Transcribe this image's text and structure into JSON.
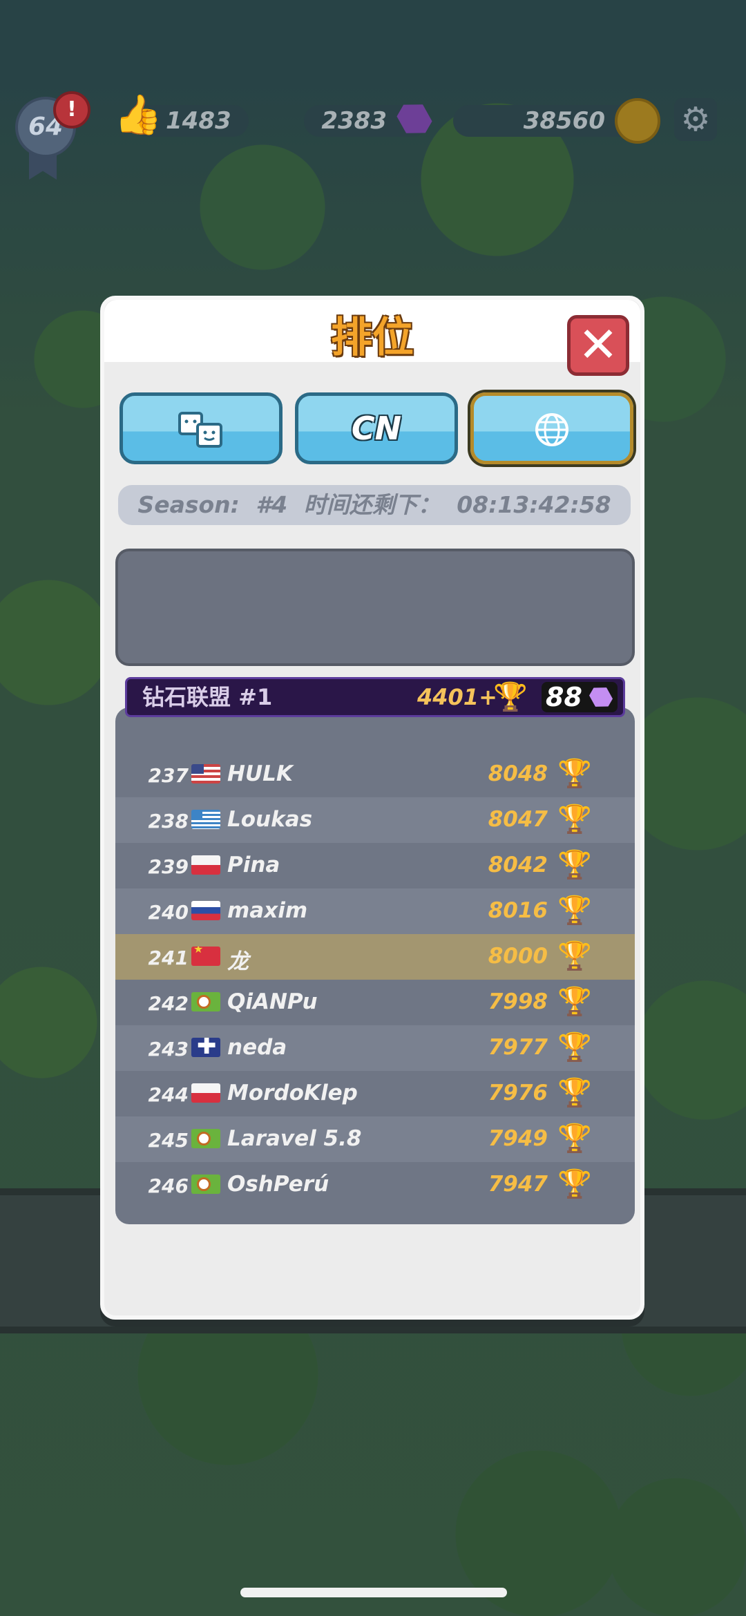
{
  "topbar": {
    "level": "64",
    "alert": "!",
    "likes": "1483",
    "gems": "2383",
    "coins": "38560",
    "icons": [
      "level-badge-icon",
      "thumb-up-icon",
      "gem-icon",
      "coin-icon",
      "gear-icon"
    ]
  },
  "modal": {
    "title": "排位",
    "close_symbol": "✕",
    "tabs": [
      {
        "label": "",
        "icon": "friends-icon"
      },
      {
        "label": "CN"
      },
      {
        "label": "",
        "icon": "globe-icon",
        "active": true
      }
    ],
    "season_label": "Season:",
    "season_number": "#4",
    "time_left_label": "时间还剩下：",
    "time_left": "08:13:42:58"
  },
  "league": {
    "name": "钻石联盟 #1",
    "trophies": "4401+",
    "gems": "88"
  },
  "leaderboard": [
    {
      "rank": "237",
      "flag": "us",
      "name": "HULK",
      "score": "8048"
    },
    {
      "rank": "238",
      "flag": "gr",
      "name": "Loukas",
      "score": "8047"
    },
    {
      "rank": "239",
      "flag": "pl",
      "name": "Pina",
      "score": "8042"
    },
    {
      "rank": "240",
      "flag": "ru",
      "name": "maxim",
      "score": "8016"
    },
    {
      "rank": "241",
      "flag": "cn",
      "name": "龙",
      "score": "8000",
      "highlight": true
    },
    {
      "rank": "242",
      "flag": "custom",
      "name": "QiANPu",
      "score": "7998"
    },
    {
      "rank": "243",
      "flag": "gb",
      "name": "neda",
      "score": "7977"
    },
    {
      "rank": "244",
      "flag": "pl",
      "name": "MordoKlep",
      "score": "7976"
    },
    {
      "rank": "245",
      "flag": "custom",
      "name": "Laravel 5.8",
      "score": "7949"
    },
    {
      "rank": "246",
      "flag": "custom",
      "name": "OshPerú",
      "score": "7947"
    }
  ],
  "colors": {
    "title": "#f4a42a",
    "score": "#f6bd45",
    "highlight_row": "#a39670",
    "close_button": "#d95058",
    "tab": "#5bbde6"
  }
}
